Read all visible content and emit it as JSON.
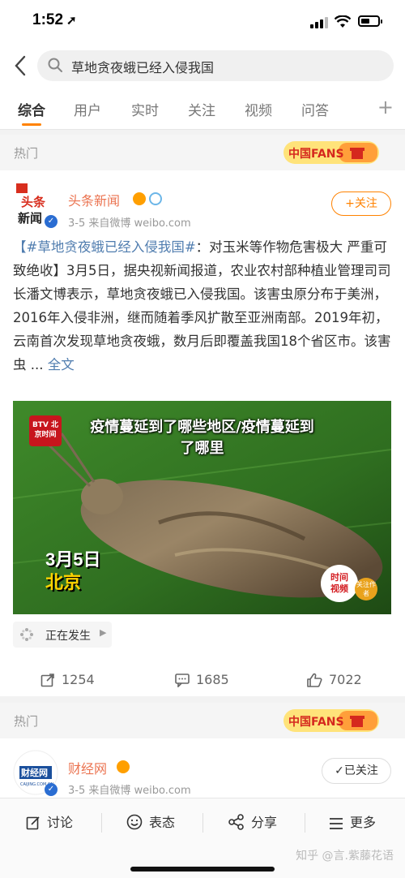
{
  "status": {
    "time": "1:52"
  },
  "search": {
    "query": "草地贪夜蛾已经入侵我国"
  },
  "tabs": [
    {
      "label": "综合"
    },
    {
      "label": "用户"
    },
    {
      "label": "实时"
    },
    {
      "label": "关注"
    },
    {
      "label": "视频"
    },
    {
      "label": "问答"
    }
  ],
  "section_label": "热门",
  "fans_badge_text": "中国FANS",
  "post1": {
    "author": "头条新闻",
    "avatar_text": "头条新闻",
    "meta": "3-5  来自微博 weibo.com",
    "follow_label": "+关注",
    "topic": "【#草地贪夜蛾已经入侵我国#",
    "body": "：对玉米等作物危害极大 严重可致绝收】3月5日，据央视新闻报道，农业农村部种植业管理司司长潘文博表示，草地贪夜蛾已入侵我国。该害虫原分布于美洲，2016年入侵非洲，继而随着季风扩散至亚洲南部。2019年初，云南首次发现草地贪夜蛾，数月后即覆盖我国18个省区市。该害虫 ...",
    "more": "全文",
    "video": {
      "title_line1": "疫情蔓延到了哪些地区/疫情蔓延到",
      "title_line2": "了哪里",
      "btv_logo": "BTV 北京时间",
      "date_line1": "3月5日",
      "date_line2": "北京",
      "time_logo_line1": "时间",
      "time_logo_line2": "视频",
      "side_badge": "关注作者"
    },
    "tag": "正在发生",
    "reposts": "1254",
    "comments": "1685",
    "likes": "7022"
  },
  "post2": {
    "author": "财经网",
    "avatar_text": "财经网",
    "avatar_sub": "CAIJING.COM.CN",
    "meta": "3-5  来自微博 weibo.com",
    "following_label": "✓已关注"
  },
  "bottom_bar": {
    "discuss": "讨论",
    "express": "表态",
    "share": "分享",
    "more": "更多"
  },
  "watermark": "知乎 @言.紫藤花语",
  "colors": {
    "accent": "#ff8200",
    "link": "#507daf",
    "author": "#eb7350"
  }
}
